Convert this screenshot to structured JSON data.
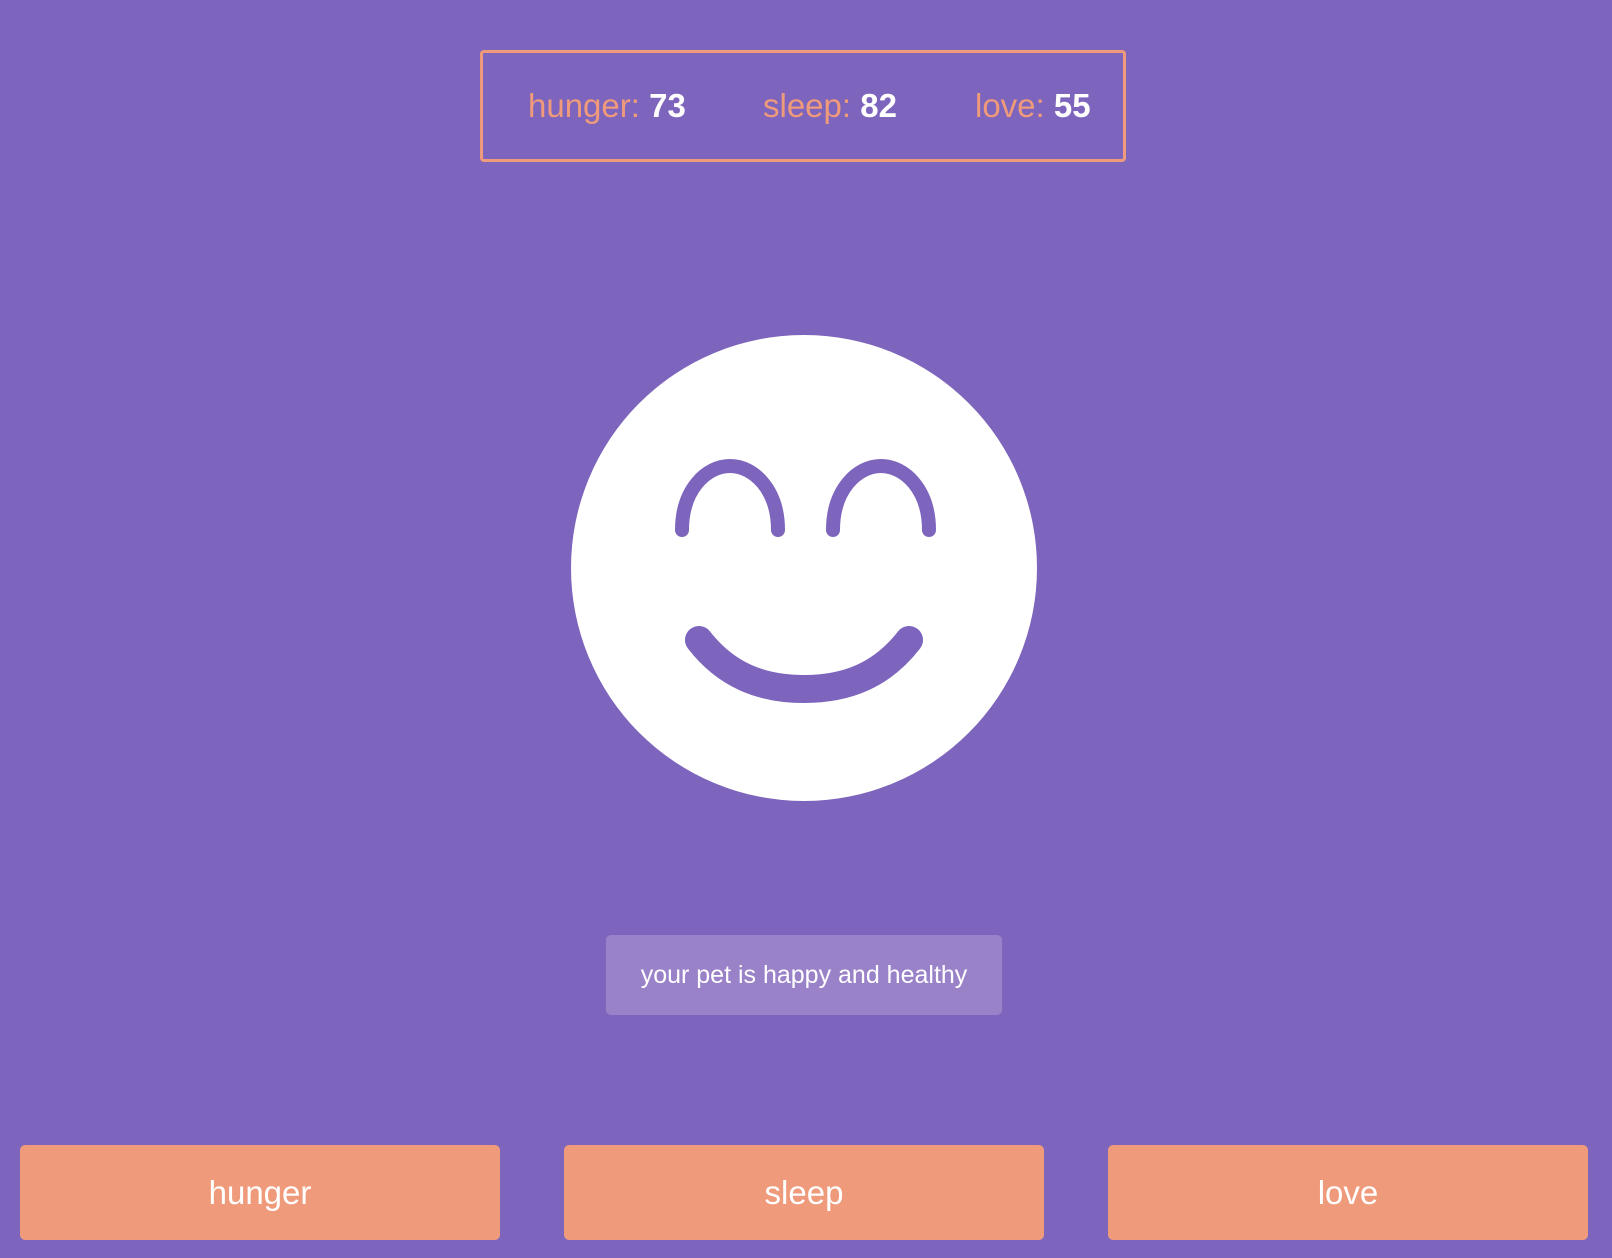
{
  "stats": {
    "hunger": {
      "label": "hunger:",
      "value": "73"
    },
    "sleep": {
      "label": "sleep:",
      "value": "82"
    },
    "love": {
      "label": "love:",
      "value": "55"
    }
  },
  "pet": {
    "face_icon": "happy-face-icon",
    "message": "your pet is happy and healthy"
  },
  "actions": {
    "hunger_label": "hunger",
    "sleep_label": "sleep",
    "love_label": "love"
  },
  "colors": {
    "background": "#7d64bc",
    "accent": "#ef9a7a",
    "message_bg": "#9a82c8",
    "text": "#ffffff"
  }
}
